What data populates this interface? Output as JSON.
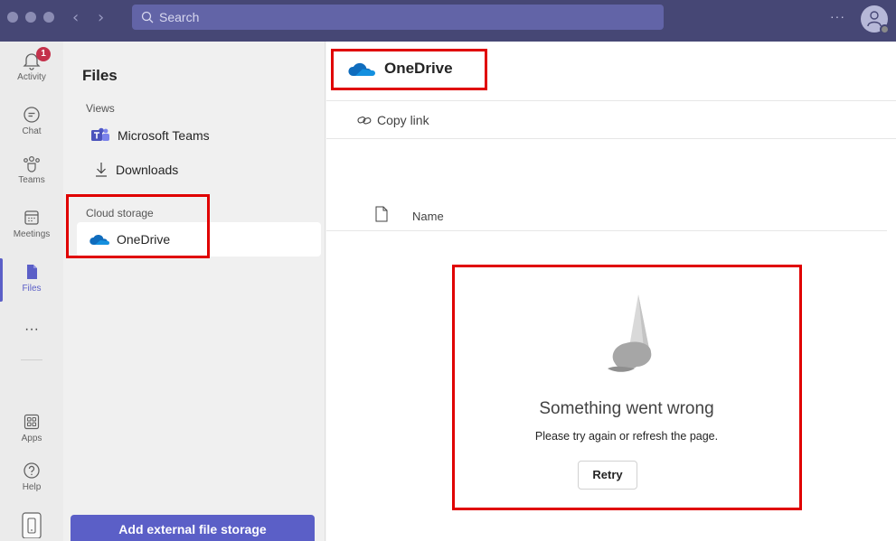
{
  "titlebar": {
    "search_placeholder": "Search",
    "more_label": "···"
  },
  "appbar": {
    "activity_badge": "1",
    "items": [
      {
        "label": "Activity",
        "icon": "bell-icon"
      },
      {
        "label": "Chat",
        "icon": "chat-icon"
      },
      {
        "label": "Teams",
        "icon": "teams-icon"
      },
      {
        "label": "Meetings",
        "icon": "calendar-icon"
      },
      {
        "label": "Files",
        "icon": "file-icon"
      },
      {
        "label": "···",
        "icon": "more-icon"
      },
      {
        "label": "Apps",
        "icon": "apps-icon"
      },
      {
        "label": "Help",
        "icon": "help-icon"
      }
    ],
    "active": "Files"
  },
  "files_pane": {
    "title": "Files",
    "views_label": "Views",
    "views": [
      {
        "label": "Microsoft Teams",
        "icon": "teams-logo-icon"
      },
      {
        "label": "Downloads",
        "icon": "download-icon"
      }
    ],
    "cloud_label": "Cloud storage",
    "cloud_items": [
      {
        "label": "OneDrive",
        "icon": "onedrive-icon"
      }
    ],
    "add_button": "Add external file storage"
  },
  "main": {
    "title": "OneDrive",
    "toolbar": {
      "copy_link": "Copy link"
    },
    "column_name": "Name",
    "error": {
      "title": "Something went wrong",
      "message": "Please try again or refresh the page.",
      "retry": "Retry"
    }
  },
  "colors": {
    "titlebar": "#464775",
    "search": "#6264a7",
    "accent": "#5b5fc7",
    "badge": "#c4314b",
    "highlight": "#e00000",
    "onedrive": "#0f6cbd"
  }
}
